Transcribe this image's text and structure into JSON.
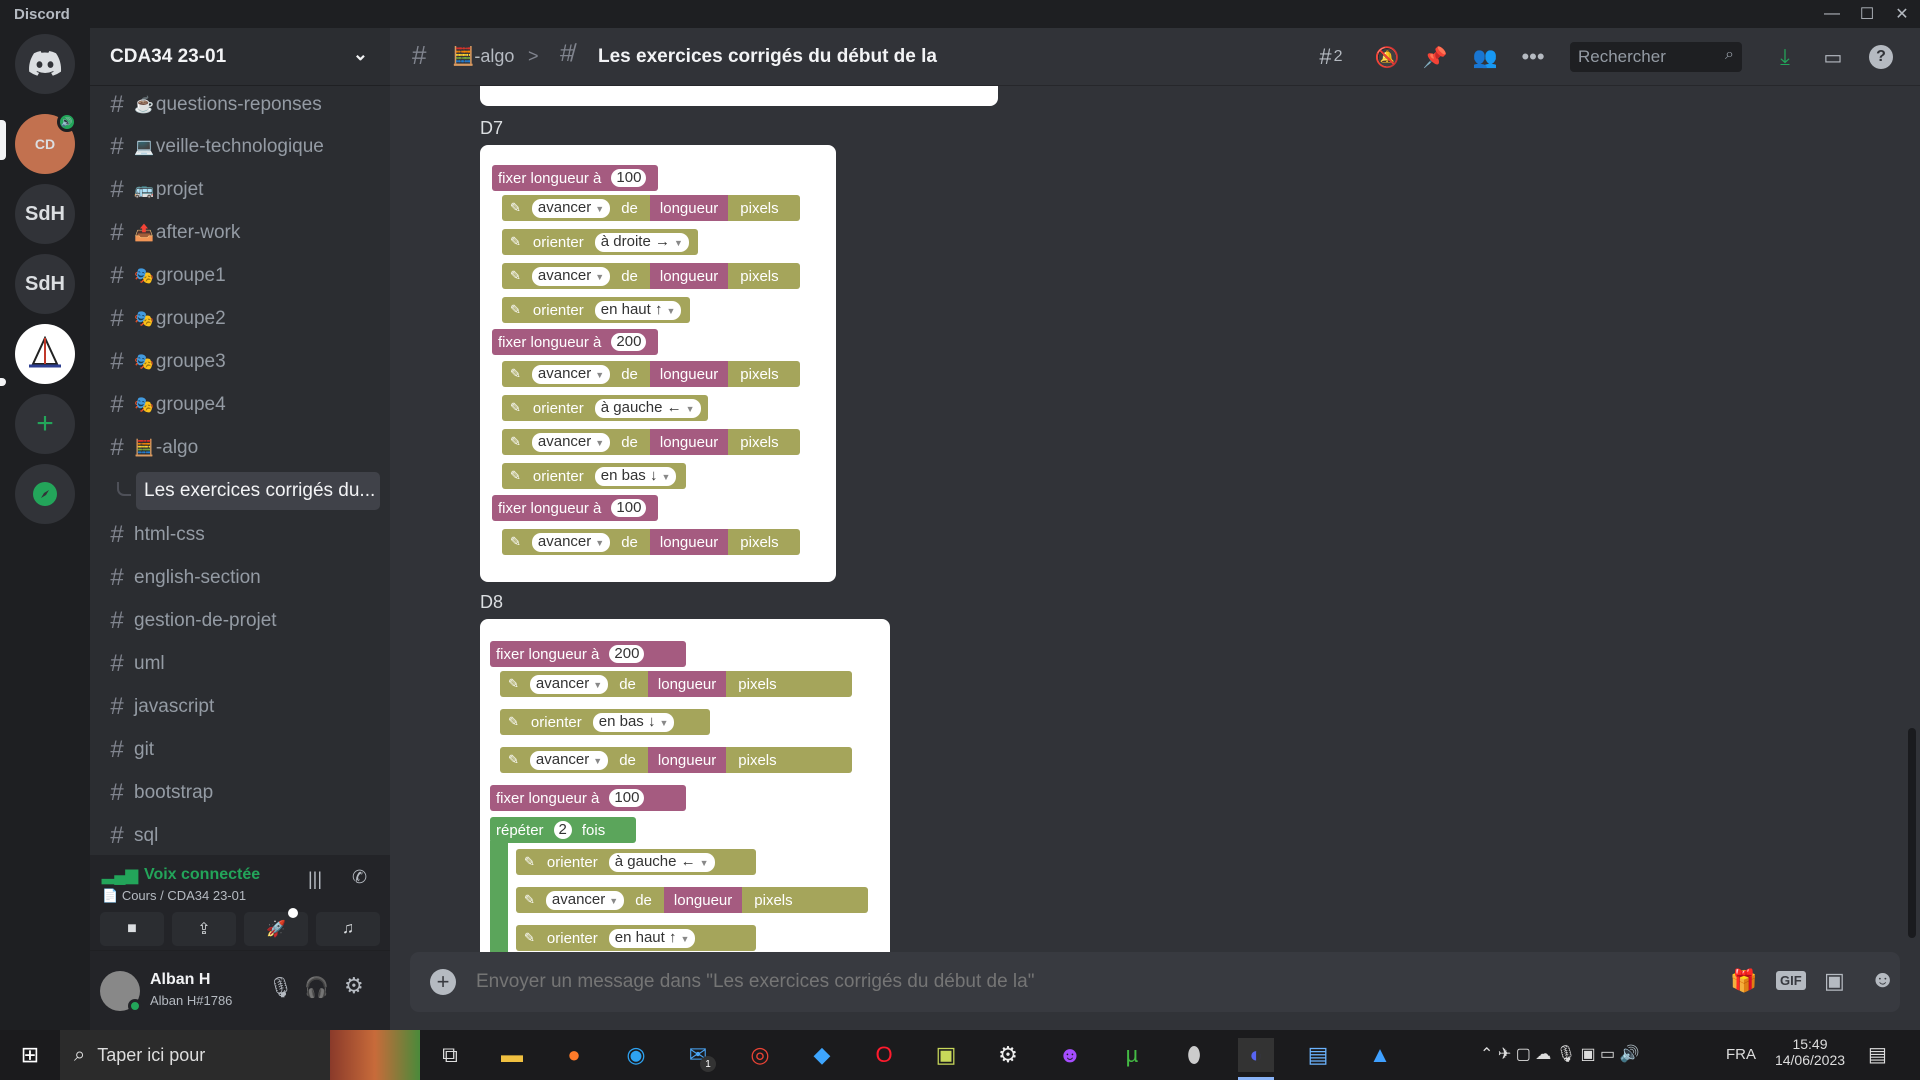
{
  "app": {
    "name": "Discord"
  },
  "guilds": {
    "items": [
      "SdH",
      "SdH"
    ],
    "badge_text": "CD"
  },
  "server": {
    "name": "CDA34 23-01"
  },
  "channels": [
    {
      "prefix": "☕",
      "name": "questions-reponses"
    },
    {
      "prefix": "💻",
      "name": "veille-technologique"
    },
    {
      "prefix": "🚌",
      "name": "projet"
    },
    {
      "prefix": "📤",
      "name": "after-work"
    },
    {
      "prefix": "🎭",
      "name": "groupe1"
    },
    {
      "prefix": "🎭",
      "name": "groupe2"
    },
    {
      "prefix": "🎭",
      "name": "groupe3"
    },
    {
      "prefix": "🎭",
      "name": "groupe4"
    },
    {
      "prefix": "🧮",
      "name": "-algo"
    },
    {
      "prefix": "",
      "name": "html-css"
    },
    {
      "prefix": "",
      "name": "english-section"
    },
    {
      "prefix": "",
      "name": "gestion-de-projet"
    },
    {
      "prefix": "",
      "name": "uml"
    },
    {
      "prefix": "",
      "name": "javascript"
    },
    {
      "prefix": "",
      "name": "git"
    },
    {
      "prefix": "",
      "name": "bootstrap"
    },
    {
      "prefix": "",
      "name": "sql"
    }
  ],
  "thread": {
    "name": "Les exercices corrigés du..."
  },
  "voice": {
    "status": "Voix connectée",
    "location": "Cours / CDA34 23-01"
  },
  "user": {
    "name": "Alban H",
    "tag": "Alban H#1786"
  },
  "header": {
    "parent_channel": "-algo",
    "parent_prefix": "🧮",
    "separator": ">",
    "thread_title": "Les exercices corrigés du début de la",
    "threads_count": "2",
    "search_placeholder": "Rechercher"
  },
  "messages": {
    "d7_label": "D7",
    "d8_label": "D8"
  },
  "blocks": {
    "set": "fixer longueur à",
    "avancer": "avancer",
    "de": "de",
    "longueur": "longueur",
    "pixels": "pixels",
    "orienter": "orienter",
    "droite": "à droite →",
    "haut": "en haut ↑",
    "gauche": "à gauche ←",
    "bas": "en bas ↓",
    "v100": "100",
    "v200": "200",
    "repeter": "répéter",
    "v2": "2",
    "fois": "fois"
  },
  "composer": {
    "placeholder": "Envoyer un message dans \"Les exercices corrigés du début de la\"",
    "gif": "GIF"
  },
  "taskbar": {
    "search": "Taper ici pour",
    "lang": "FRA",
    "time": "15:49",
    "date": "14/06/2023",
    "mail_badge": "1"
  },
  "colors": {
    "accent": "#5865f2",
    "voice_green": "#23a55a",
    "block_set": "#a55b80",
    "block_cmd": "#a5a55b",
    "block_repeat": "#5ba55b"
  }
}
